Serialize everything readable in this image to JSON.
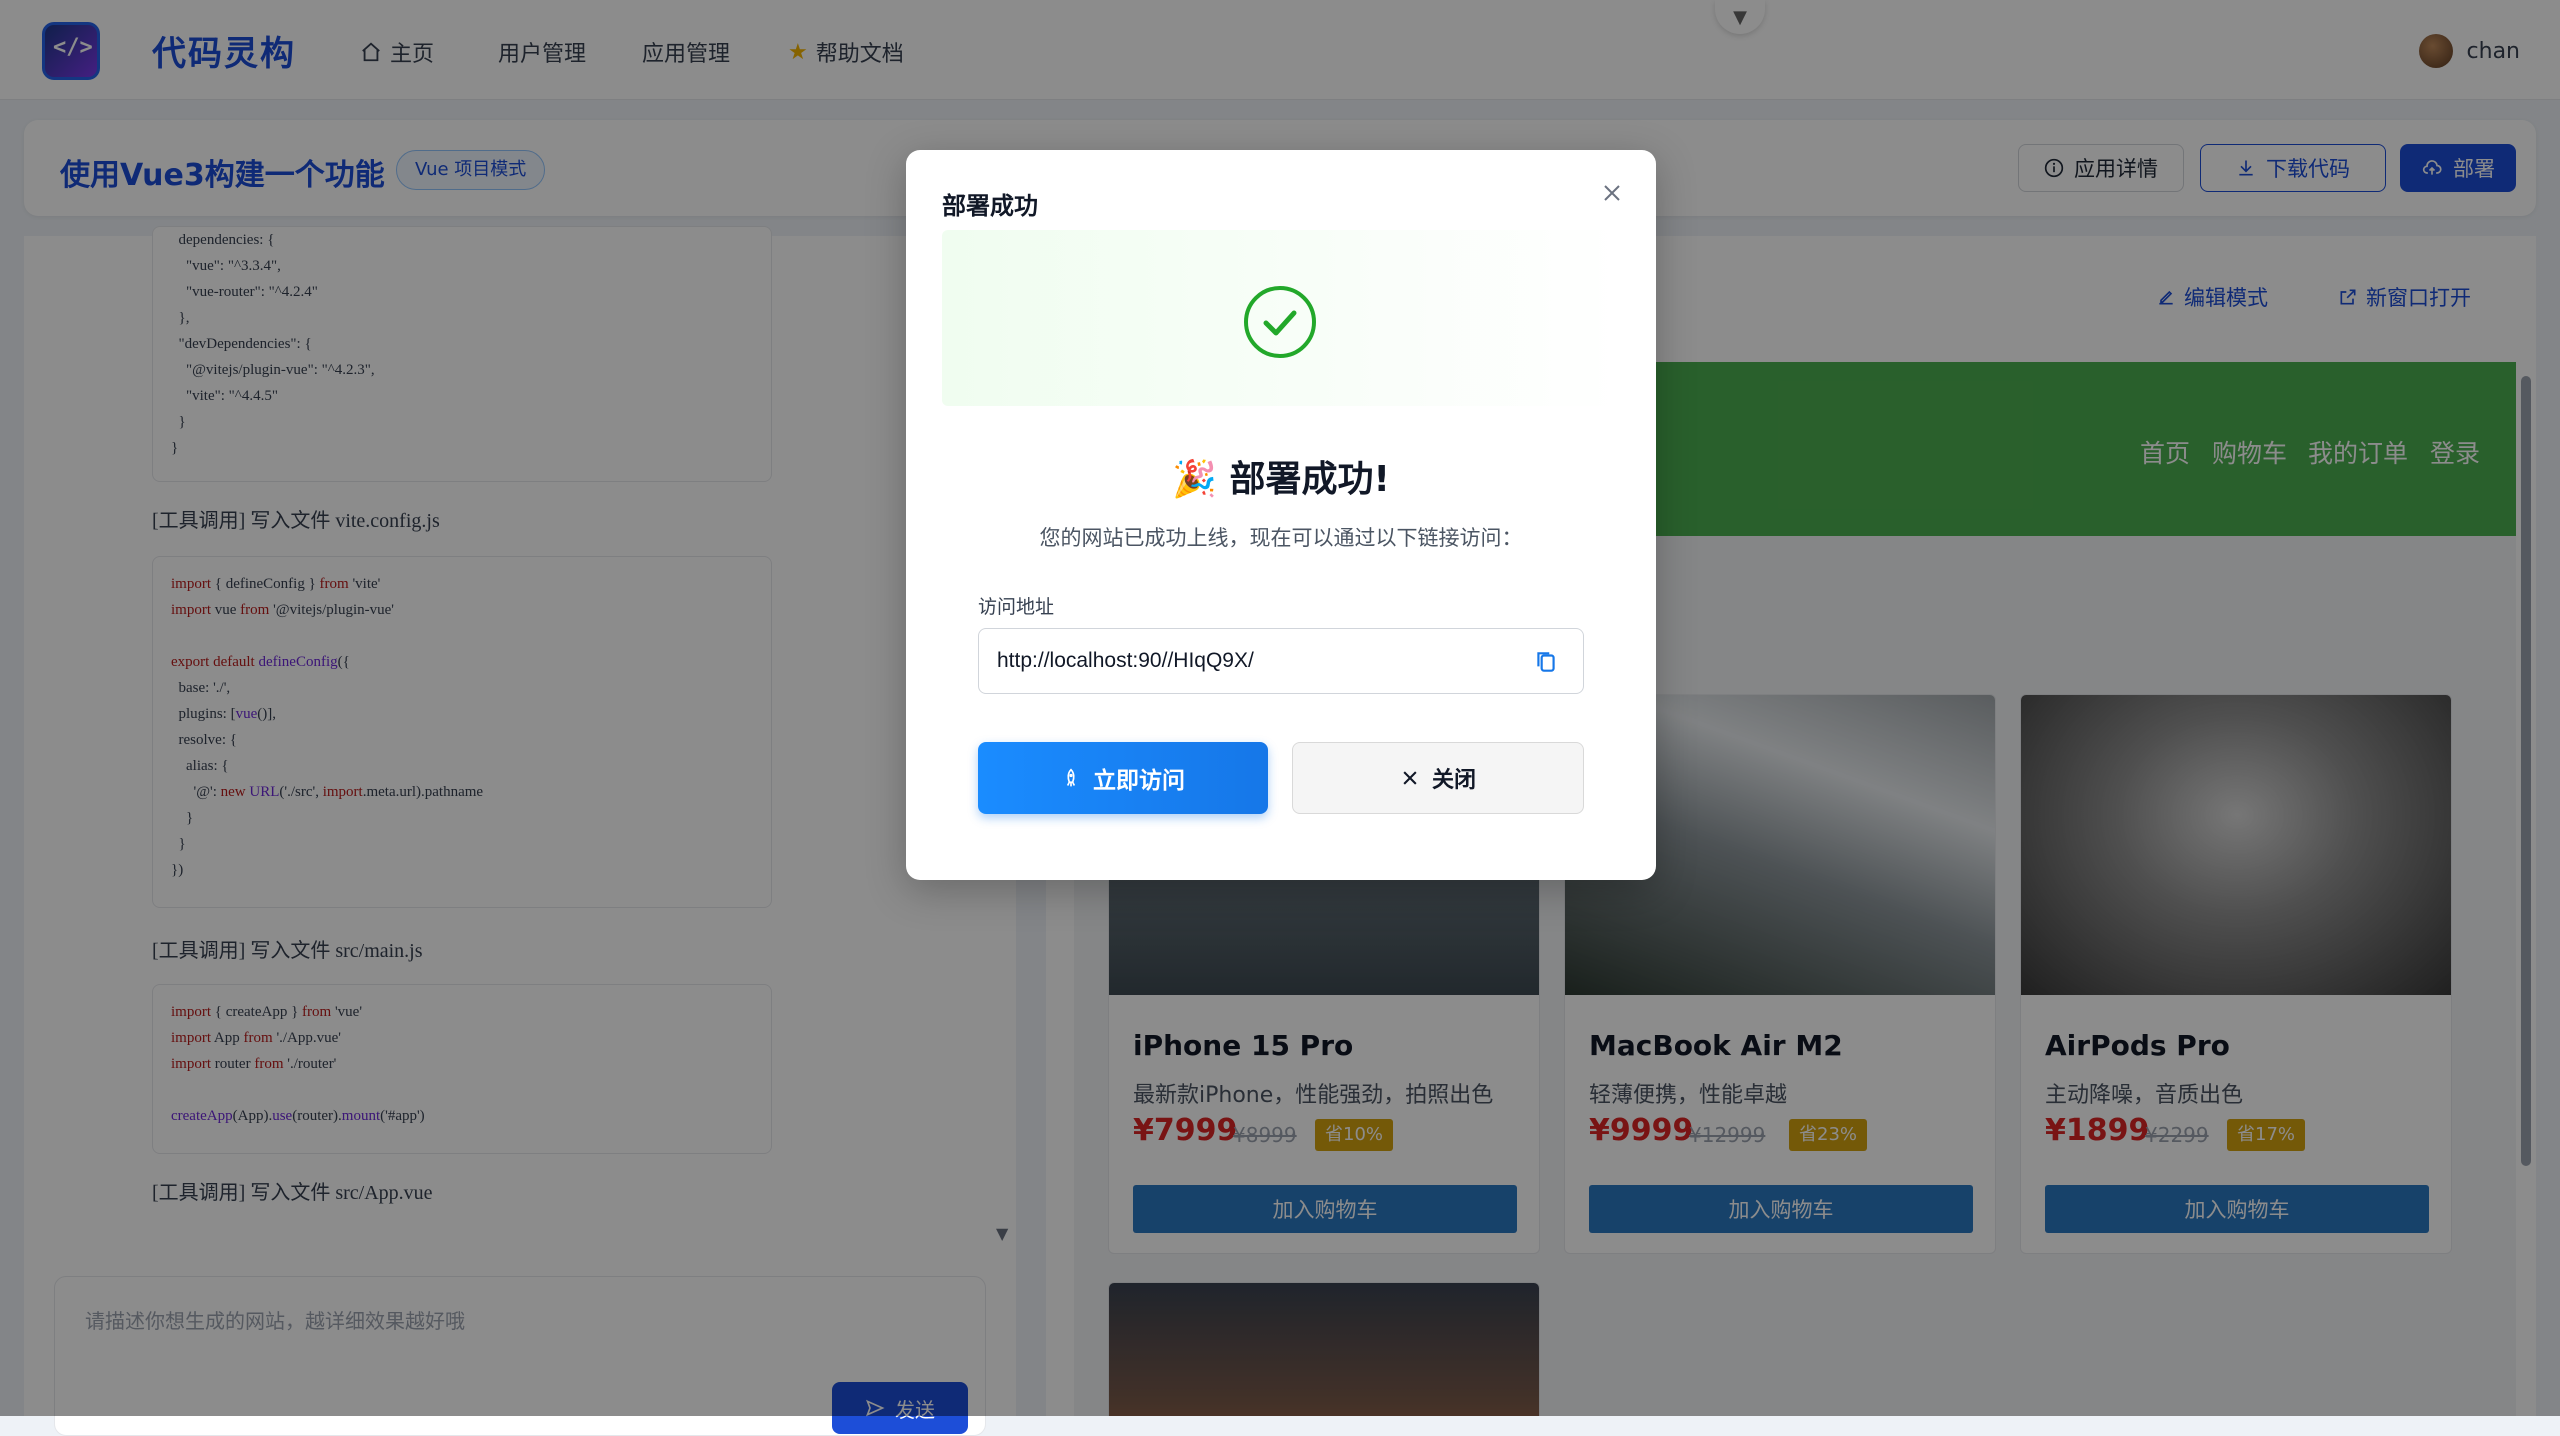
{
  "header": {
    "logo_text": "</>",
    "brand": "代码灵构",
    "nav": [
      {
        "label": "主页",
        "icon": "home-icon"
      },
      {
        "label": "用户管理"
      },
      {
        "label": "应用管理"
      },
      {
        "label": "帮助文档",
        "icon": "star-icon"
      }
    ],
    "user_name": "chan"
  },
  "project": {
    "title": "使用Vue3构建一个功能",
    "tag": "Vue 项目模式",
    "details_label": "应用详情",
    "download_label": "下载代码",
    "deploy_label": "部署"
  },
  "chat": {
    "code_top": "  dependencies: {\n    \"vue\": \"^3.3.4\",\n    \"vue-router\": \"^4.2.4\"\n  },\n  \"devDependencies\": {\n    \"@vitejs/plugin-vue\": \"^4.2.3\",\n    \"vite\": \"^4.4.5\"\n  }\n}",
    "tool1": "[工具调用] 写入文件 vite.config.js",
    "tool2": "[工具调用] 写入文件 src/main.js",
    "tool3": "[工具调用] 写入文件 src/App.vue",
    "input_placeholder": "请描述你想生成的网站，越详细效果越好哦",
    "send_label": "发送"
  },
  "preview": {
    "edit_mode_label": "编辑模式",
    "new_window_label": "新窗口打开",
    "site_nav": [
      "首页",
      "购物车",
      "我的订单",
      "登录"
    ],
    "products": [
      {
        "name": "iPhone 15 Pro",
        "desc": "最新款iPhone，性能强劲，拍照出色",
        "price": "¥7999",
        "original": "¥8999",
        "save": "省10%",
        "button": "加入购物车"
      },
      {
        "name": "MacBook Air M2",
        "desc": "轻薄便携，性能卓越",
        "price": "¥9999",
        "original": "¥12999",
        "save": "省23%",
        "button": "加入购物车"
      },
      {
        "name": "AirPods Pro",
        "desc": "主动降噪，音质出色",
        "price": "¥1899",
        "original": "¥2299",
        "save": "省17%",
        "button": "加入购物车"
      }
    ]
  },
  "modal": {
    "title": "部署成功",
    "heading": "部署成功!",
    "party_emoji": "🎉",
    "subtitle": "您的网站已成功上线，现在可以通过以下链接访问：",
    "url_label": "访问地址",
    "url_value": "http://localhost:90//HIqQ9X/",
    "visit_label": "立即访问",
    "close_label": "关闭"
  },
  "colors": {
    "brand_blue": "#1d4ed8",
    "success_green": "#22a82a",
    "site_green": "#4caf50",
    "price_red": "#dc2626"
  }
}
